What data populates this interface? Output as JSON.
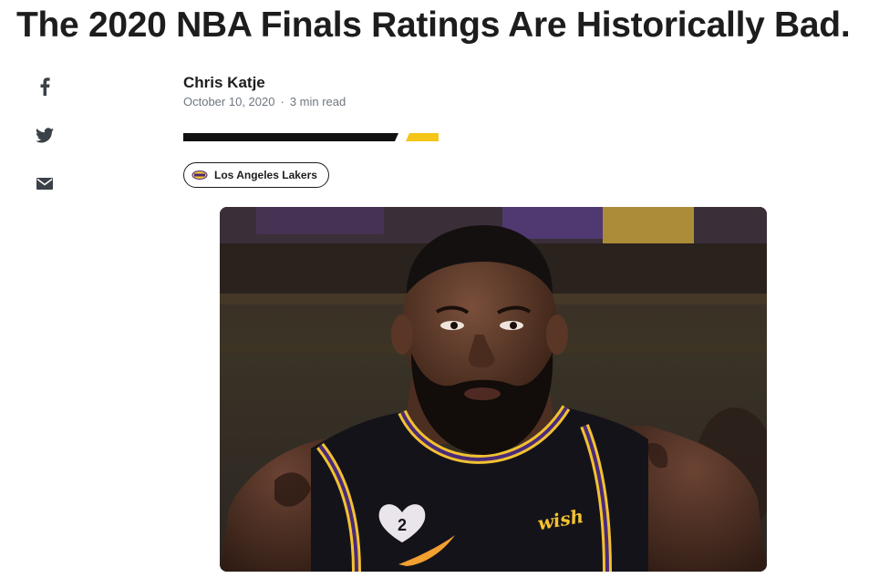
{
  "article": {
    "headline": "The 2020 NBA Finals Ratings Are Historically Bad.",
    "author": "Chris Katje",
    "date": "October 10, 2020",
    "separator": "·",
    "read_time": "3 min read",
    "tag": {
      "label": "Los Angeles Lakers",
      "icon": "lakers-logo-icon"
    }
  },
  "share": {
    "icons": [
      "facebook-icon",
      "twitter-icon",
      "email-icon"
    ]
  },
  "image": {
    "jersey_number": "2",
    "jersey_patch": "wish"
  },
  "colors": {
    "text": "#1d1d1d",
    "meta": "#6e7780",
    "accent_yellow": "#f5c518",
    "lakers_purple": "#4a2a7a",
    "lakers_gold": "#f2c230"
  }
}
